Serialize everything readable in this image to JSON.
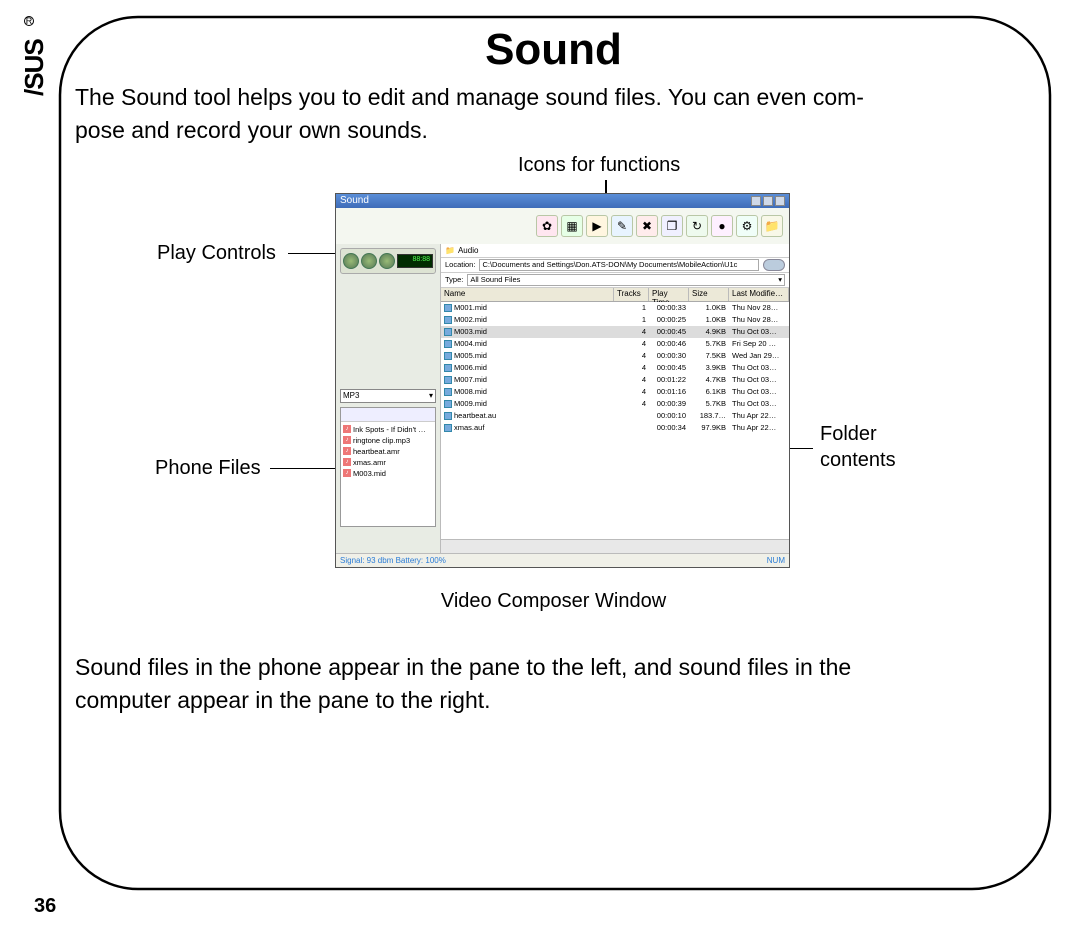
{
  "page_number": "36",
  "logo": "/SUS",
  "title": "Sound",
  "intro": "The Sound tool helps you to edit and manage sound files. You can even com-",
  "intro2": "pose and record your own sounds.",
  "callouts": {
    "icons_for_functions": "Icons for functions",
    "play_controls": "Play Controls",
    "phone_files": "Phone Files",
    "folder_contents_l1": "Folder",
    "folder_contents_l2": "contents",
    "caption": "Video Composer Window"
  },
  "outro": "Sound files in the phone appear in the pane to the left, and sound files in the",
  "outro2": "computer appear in the pane to the right.",
  "window": {
    "title": "Sound",
    "play_disp": "88:88",
    "format_sel": "MP3",
    "phone_list": [
      "Ink Spots - If  Didn't …",
      "ringtone clip.mp3",
      "heartbeat.amr",
      "xmas.amr",
      "M003.mid"
    ],
    "crumb_icon": "📁",
    "crumb": "Audio",
    "loc_label": "Location:",
    "loc_value": "C:\\Documents and Settings\\Don.ATS-DON\\My Documents\\MobileAction\\U1c",
    "type_label": "Type:",
    "type_value": "All Sound Files",
    "headers": {
      "name": "Name",
      "tracks": "Tracks",
      "play": "Play Time",
      "size": "Size",
      "mod": "Last Modifie…"
    },
    "rows": [
      {
        "n": "M001.mid",
        "t": "1",
        "p": "00:00:33",
        "s": "1.0KB",
        "m": "Thu Nov 28…"
      },
      {
        "n": "M002.mid",
        "t": "1",
        "p": "00:00:25",
        "s": "1.0KB",
        "m": "Thu Nov 28…"
      },
      {
        "n": "M003.mid",
        "t": "4",
        "p": "00:00:45",
        "s": "4.9KB",
        "m": "Thu Oct 03…",
        "sel": true
      },
      {
        "n": "M004.mid",
        "t": "4",
        "p": "00:00:46",
        "s": "5.7KB",
        "m": "Fri Sep 20 …"
      },
      {
        "n": "M005.mid",
        "t": "4",
        "p": "00:00:30",
        "s": "7.5KB",
        "m": "Wed Jan 29…"
      },
      {
        "n": "M006.mid",
        "t": "4",
        "p": "00:00:45",
        "s": "3.9KB",
        "m": "Thu Oct 03…"
      },
      {
        "n": "M007.mid",
        "t": "4",
        "p": "00:01:22",
        "s": "4.7KB",
        "m": "Thu Oct 03…"
      },
      {
        "n": "M008.mid",
        "t": "4",
        "p": "00:01:16",
        "s": "6.1KB",
        "m": "Thu Oct 03…"
      },
      {
        "n": "M009.mid",
        "t": "4",
        "p": "00:00:39",
        "s": "5.7KB",
        "m": "Thu Oct 03…"
      },
      {
        "n": "heartbeat.au",
        "t": "",
        "p": "00:00:10",
        "s": "183.7…",
        "m": "Thu Apr 22…"
      },
      {
        "n": "xmas.auf",
        "t": "",
        "p": "00:00:34",
        "s": "97.9KB",
        "m": "Thu Apr 22…"
      }
    ],
    "status_sig": "Signal: 93 dbm Battery: 100%",
    "status_num": "NUM"
  }
}
